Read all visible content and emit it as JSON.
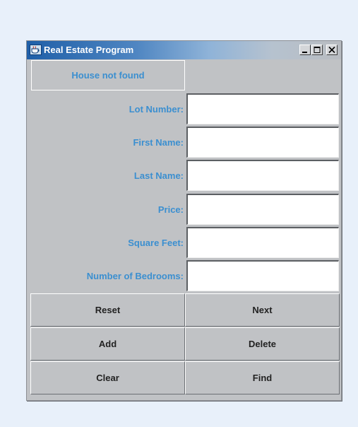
{
  "window": {
    "title": "Real Estate Program",
    "app_icon": "java-cup-icon",
    "controls": {
      "minimize": "minimize-icon",
      "maximize": "maximize-icon",
      "close": "close-icon"
    }
  },
  "status": {
    "text": "House not found"
  },
  "form": {
    "fields": [
      {
        "label": "Lot Number:",
        "value": ""
      },
      {
        "label": "First Name:",
        "value": ""
      },
      {
        "label": "Last Name:",
        "value": ""
      },
      {
        "label": "Price:",
        "value": ""
      },
      {
        "label": "Square Feet:",
        "value": ""
      },
      {
        "label": "Number of Bedrooms:",
        "value": ""
      }
    ]
  },
  "buttons": {
    "reset": "Reset",
    "next": "Next",
    "add": "Add",
    "delete": "Delete",
    "clear": "Clear",
    "find": "Find"
  },
  "colors": {
    "label_text": "#3b8fd0",
    "titlebar_start": "#1f5fa8",
    "window_bg": "#c0c2c5"
  }
}
